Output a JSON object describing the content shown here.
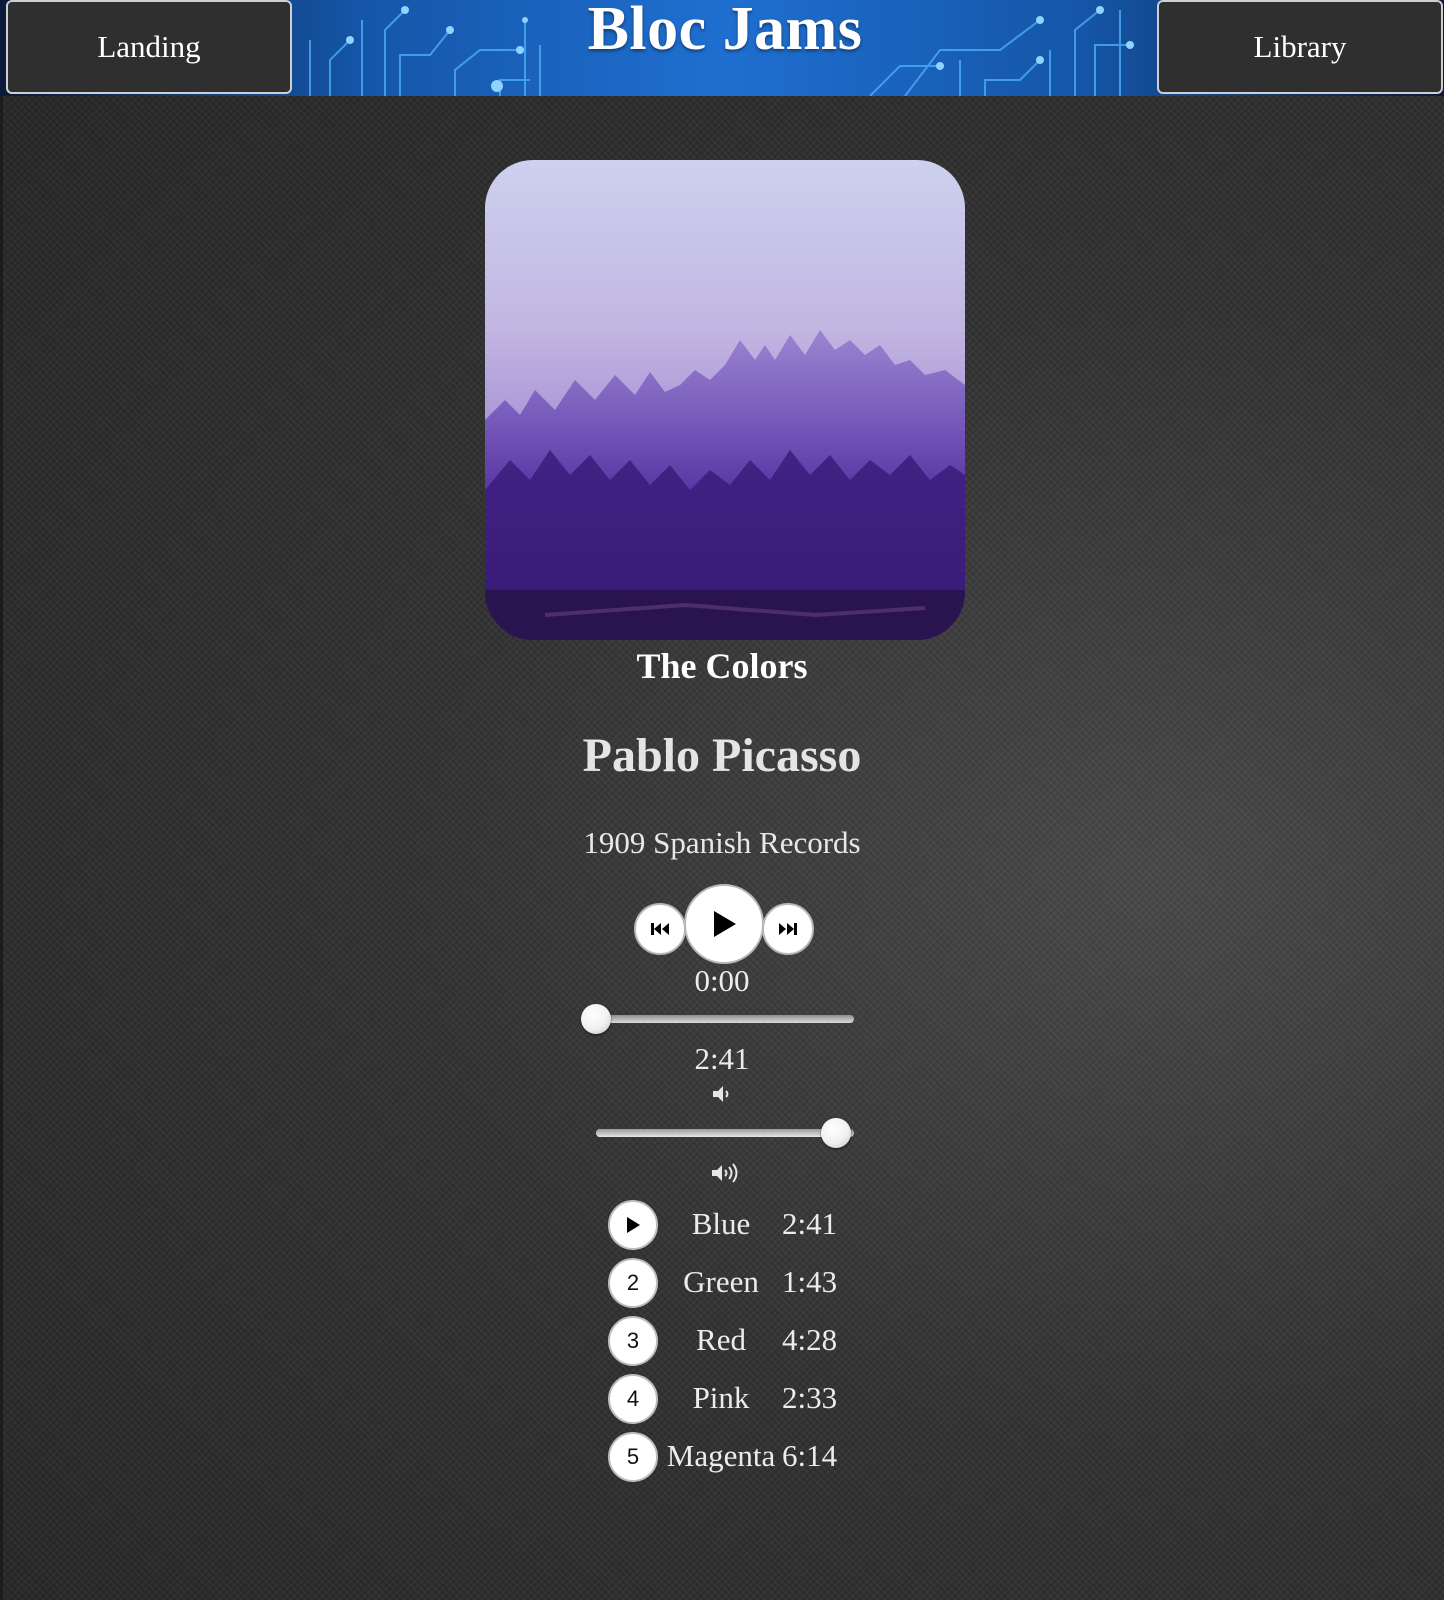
{
  "header": {
    "brand": "Bloc Jams",
    "nav_left_label": "Landing",
    "nav_right_label": "Library",
    "accent_color": "#1f6fd0"
  },
  "album": {
    "title": "The Colors",
    "artist": "Pablo Picasso",
    "release_info": "1909 Spanish Records",
    "cover_icon": "misty-forest-image"
  },
  "player": {
    "prev_icon": "skip-previous-icon",
    "play_icon": "play-icon",
    "next_icon": "skip-next-icon",
    "current_time": "0:00",
    "total_time": "2:41",
    "seek_fraction": 0.0,
    "volume_fraction": 0.93,
    "volume_low_icon": "volume-low-icon",
    "volume_high_icon": "volume-high-icon"
  },
  "songs": [
    {
      "number": "1",
      "title": "Blue",
      "duration": "2:41",
      "state": "play-icon"
    },
    {
      "number": "2",
      "title": "Green",
      "duration": "1:43"
    },
    {
      "number": "3",
      "title": "Red",
      "duration": "4:28"
    },
    {
      "number": "4",
      "title": "Pink",
      "duration": "2:33"
    },
    {
      "number": "5",
      "title": "Magenta",
      "duration": "6:14"
    }
  ]
}
